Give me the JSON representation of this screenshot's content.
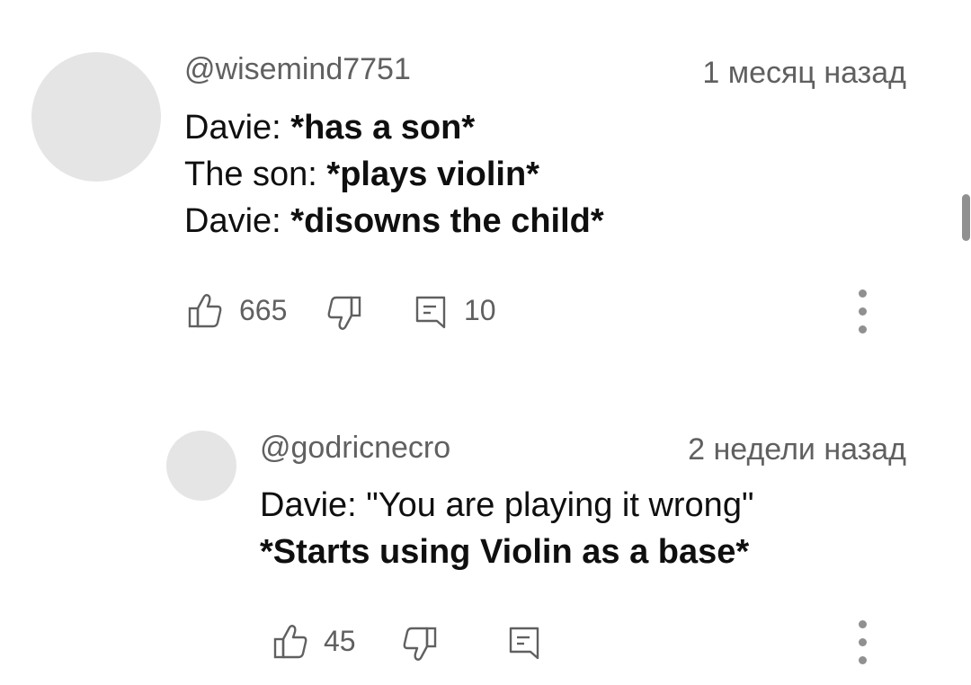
{
  "comments": [
    {
      "author": "@wisemind7751",
      "time": "1 месяц назад",
      "lines": [
        {
          "prefix": "Davie: ",
          "bold": "*has a son*"
        },
        {
          "prefix": "The son: ",
          "bold": "*plays violin*"
        },
        {
          "prefix": "Davie: ",
          "bold": "*disowns the child*"
        }
      ],
      "likes": "665",
      "replies": "10",
      "icons": {
        "like": "thumbs-up-icon",
        "dislike": "thumbs-down-icon",
        "reply": "reply-icon",
        "menu": "more-vert-icon"
      }
    },
    {
      "author": "@godricnecro",
      "time": "2 недели назад",
      "lines": [
        {
          "prefix": "Davie: \"You are playing it wrong\"",
          "bold": ""
        },
        {
          "prefix": "",
          "bold": "*Starts using Violin as a base*"
        }
      ],
      "likes": "45",
      "replies": "",
      "icons": {
        "like": "thumbs-up-icon",
        "dislike": "thumbs-down-icon",
        "reply": "reply-icon",
        "menu": "more-vert-icon"
      }
    }
  ],
  "colors": {
    "avatar": "#e5e5e5",
    "meta_text": "#606060",
    "body_text": "#0f0f0f",
    "icon": "#606060"
  }
}
